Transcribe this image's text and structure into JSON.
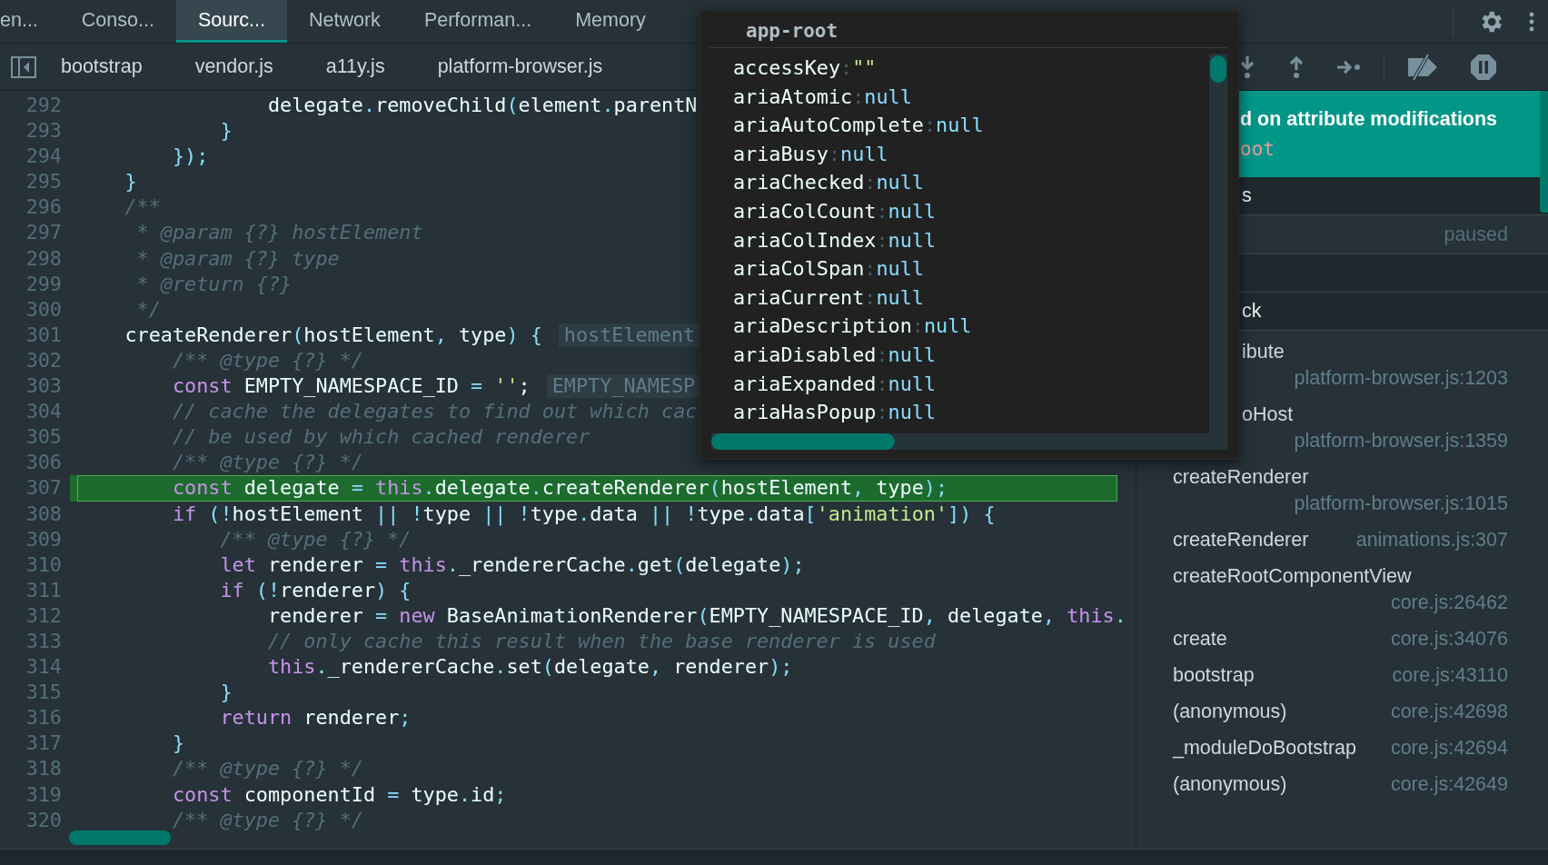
{
  "top_tabs": [
    {
      "label": "en...",
      "selected": false
    },
    {
      "label": "Conso...",
      "selected": false
    },
    {
      "label": "Sourc...",
      "selected": true
    },
    {
      "label": "Network",
      "selected": false
    },
    {
      "label": "Performan...",
      "selected": false
    },
    {
      "label": "Memory",
      "selected": false
    }
  ],
  "file_tabs": [
    "bootstrap",
    "vendor.js",
    "a11y.js",
    "platform-browser.js"
  ],
  "code": {
    "lines": [
      {
        "number": "292",
        "highlighted": false,
        "tokens": [
          {
            "text": "                delegate",
            "kind": "plain"
          },
          {
            "text": ".",
            "kind": "punct"
          },
          {
            "text": "removeChild",
            "kind": "plain"
          },
          {
            "text": "(",
            "kind": "punct"
          },
          {
            "text": "element",
            "kind": "plain"
          },
          {
            "text": ".",
            "kind": "punct"
          },
          {
            "text": "parentN",
            "kind": "plain"
          }
        ]
      },
      {
        "number": "293",
        "highlighted": false,
        "tokens": [
          {
            "text": "            }",
            "kind": "punct"
          }
        ]
      },
      {
        "number": "294",
        "highlighted": false,
        "tokens": [
          {
            "text": "        });",
            "kind": "punct"
          }
        ]
      },
      {
        "number": "295",
        "highlighted": false,
        "tokens": [
          {
            "text": "    }",
            "kind": "punct"
          }
        ]
      },
      {
        "number": "296",
        "highlighted": false,
        "tokens": [
          {
            "text": "    /**",
            "kind": "comment"
          }
        ]
      },
      {
        "number": "297",
        "highlighted": false,
        "tokens": [
          {
            "text": "     * @param {?} hostElement",
            "kind": "comment"
          }
        ]
      },
      {
        "number": "298",
        "highlighted": false,
        "tokens": [
          {
            "text": "     * @param {?} type",
            "kind": "comment"
          }
        ]
      },
      {
        "number": "299",
        "highlighted": false,
        "tokens": [
          {
            "text": "     * @return {?}",
            "kind": "comment"
          }
        ]
      },
      {
        "number": "300",
        "highlighted": false,
        "tokens": [
          {
            "text": "     */",
            "kind": "comment"
          }
        ]
      },
      {
        "number": "301",
        "highlighted": false,
        "tokens": [
          {
            "text": "    createRenderer",
            "kind": "plain"
          },
          {
            "text": "(",
            "kind": "punct"
          },
          {
            "text": "hostElement",
            "kind": "plain"
          },
          {
            "text": ", ",
            "kind": "punct"
          },
          {
            "text": "type",
            "kind": "plain"
          },
          {
            "text": ") {",
            "kind": "punct"
          }
        ],
        "hint": "hostElement"
      },
      {
        "number": "302",
        "highlighted": false,
        "tokens": [
          {
            "text": "        /** @type {?} */",
            "kind": "comment"
          }
        ]
      },
      {
        "number": "303",
        "highlighted": false,
        "tokens": [
          {
            "text": "        const",
            "kind": "keyword"
          },
          {
            "text": " EMPTY_NAMESPACE_ID ",
            "kind": "plain"
          },
          {
            "text": "= ",
            "kind": "punct"
          },
          {
            "text": "''",
            "kind": "string"
          },
          {
            "text": ";",
            "kind": "plain"
          }
        ],
        "hint": "EMPTY_NAMESP"
      },
      {
        "number": "304",
        "highlighted": false,
        "tokens": [
          {
            "text": "        // cache the delegates to find out which cac",
            "kind": "comment"
          }
        ]
      },
      {
        "number": "305",
        "highlighted": false,
        "tokens": [
          {
            "text": "        // be used by which cached renderer",
            "kind": "comment"
          }
        ]
      },
      {
        "number": "306",
        "highlighted": false,
        "tokens": [
          {
            "text": "        /** @type {?} */",
            "kind": "comment"
          }
        ]
      },
      {
        "number": "307",
        "highlighted": true,
        "tokens": [
          {
            "text": "        const",
            "kind": "keyword"
          },
          {
            "text": " delegate ",
            "kind": "plain"
          },
          {
            "text": "=",
            "kind": "punct"
          },
          {
            "text": " this",
            "kind": "keyword"
          },
          {
            "text": ".",
            "kind": "punct"
          },
          {
            "text": "delegate",
            "kind": "plain"
          },
          {
            "text": ".",
            "kind": "punct"
          },
          {
            "text": "createRenderer",
            "kind": "plain"
          },
          {
            "text": "(",
            "kind": "punct"
          },
          {
            "text": "hostElement",
            "kind": "plain"
          },
          {
            "text": ", ",
            "kind": "punct"
          },
          {
            "text": "type",
            "kind": "plain"
          },
          {
            "text": ");",
            "kind": "punct"
          }
        ]
      },
      {
        "number": "308",
        "highlighted": false,
        "tokens": [
          {
            "text": "        if",
            "kind": "keyword"
          },
          {
            "text": " (!",
            "kind": "punct"
          },
          {
            "text": "hostElement ",
            "kind": "plain"
          },
          {
            "text": "|| !",
            "kind": "punct"
          },
          {
            "text": "type ",
            "kind": "plain"
          },
          {
            "text": "|| !",
            "kind": "punct"
          },
          {
            "text": "type",
            "kind": "plain"
          },
          {
            "text": ".",
            "kind": "punct"
          },
          {
            "text": "data ",
            "kind": "plain"
          },
          {
            "text": "|| !",
            "kind": "punct"
          },
          {
            "text": "type",
            "kind": "plain"
          },
          {
            "text": ".",
            "kind": "punct"
          },
          {
            "text": "data",
            "kind": "plain"
          },
          {
            "text": "[",
            "kind": "punct"
          },
          {
            "text": "'animation'",
            "kind": "string"
          },
          {
            "text": "]) {",
            "kind": "punct"
          }
        ]
      },
      {
        "number": "309",
        "highlighted": false,
        "tokens": [
          {
            "text": "            /** @type {?} */",
            "kind": "comment"
          }
        ]
      },
      {
        "number": "310",
        "highlighted": false,
        "tokens": [
          {
            "text": "            let",
            "kind": "keyword"
          },
          {
            "text": " renderer ",
            "kind": "plain"
          },
          {
            "text": "=",
            "kind": "punct"
          },
          {
            "text": " this",
            "kind": "keyword"
          },
          {
            "text": ".",
            "kind": "punct"
          },
          {
            "text": "_rendererCache",
            "kind": "plain"
          },
          {
            "text": ".",
            "kind": "punct"
          },
          {
            "text": "get",
            "kind": "plain"
          },
          {
            "text": "(",
            "kind": "punct"
          },
          {
            "text": "delegate",
            "kind": "plain"
          },
          {
            "text": ");",
            "kind": "punct"
          }
        ]
      },
      {
        "number": "311",
        "highlighted": false,
        "tokens": [
          {
            "text": "            if",
            "kind": "keyword"
          },
          {
            "text": " (!",
            "kind": "punct"
          },
          {
            "text": "renderer",
            "kind": "plain"
          },
          {
            "text": ") {",
            "kind": "punct"
          }
        ]
      },
      {
        "number": "312",
        "highlighted": false,
        "tokens": [
          {
            "text": "                renderer ",
            "kind": "plain"
          },
          {
            "text": "=",
            "kind": "punct"
          },
          {
            "text": " new",
            "kind": "keyword"
          },
          {
            "text": " BaseAnimationRenderer",
            "kind": "plain"
          },
          {
            "text": "(",
            "kind": "punct"
          },
          {
            "text": "EMPTY_NAMESPACE_ID",
            "kind": "plain"
          },
          {
            "text": ", ",
            "kind": "punct"
          },
          {
            "text": "delegate",
            "kind": "plain"
          },
          {
            "text": ", ",
            "kind": "punct"
          },
          {
            "text": "this",
            "kind": "keyword"
          },
          {
            "text": ".",
            "kind": "punct"
          }
        ]
      },
      {
        "number": "313",
        "highlighted": false,
        "tokens": [
          {
            "text": "                // only cache this result when the base renderer is used",
            "kind": "comment"
          }
        ]
      },
      {
        "number": "314",
        "highlighted": false,
        "tokens": [
          {
            "text": "                this",
            "kind": "keyword"
          },
          {
            "text": ".",
            "kind": "punct"
          },
          {
            "text": "_rendererCache",
            "kind": "plain"
          },
          {
            "text": ".",
            "kind": "punct"
          },
          {
            "text": "set",
            "kind": "plain"
          },
          {
            "text": "(",
            "kind": "punct"
          },
          {
            "text": "delegate",
            "kind": "plain"
          },
          {
            "text": ", ",
            "kind": "punct"
          },
          {
            "text": "renderer",
            "kind": "plain"
          },
          {
            "text": ");",
            "kind": "punct"
          }
        ]
      },
      {
        "number": "315",
        "highlighted": false,
        "tokens": [
          {
            "text": "            }",
            "kind": "punct"
          }
        ]
      },
      {
        "number": "316",
        "highlighted": false,
        "tokens": [
          {
            "text": "            return",
            "kind": "keyword"
          },
          {
            "text": " renderer",
            "kind": "plain"
          },
          {
            "text": ";",
            "kind": "punct"
          }
        ]
      },
      {
        "number": "317",
        "highlighted": false,
        "tokens": [
          {
            "text": "        }",
            "kind": "punct"
          }
        ]
      },
      {
        "number": "318",
        "highlighted": false,
        "tokens": [
          {
            "text": "        /** @type {?} */",
            "kind": "comment"
          }
        ]
      },
      {
        "number": "319",
        "highlighted": false,
        "tokens": [
          {
            "text": "        const",
            "kind": "keyword"
          },
          {
            "text": " componentId ",
            "kind": "plain"
          },
          {
            "text": "=",
            "kind": "punct"
          },
          {
            "text": " type",
            "kind": "plain"
          },
          {
            "text": ".",
            "kind": "punct"
          },
          {
            "text": "id",
            "kind": "plain"
          },
          {
            "text": ";",
            "kind": "punct"
          }
        ]
      },
      {
        "number": "320",
        "highlighted": false,
        "tokens": [
          {
            "text": "        /** @type {?} */",
            "kind": "comment"
          }
        ]
      }
    ]
  },
  "popover": {
    "title": "app-root",
    "properties": [
      {
        "name": "accessKey",
        "separator": ":",
        "value": "\"\"",
        "kind": "string"
      },
      {
        "name": "ariaAtomic",
        "separator": ":",
        "value": "null",
        "kind": "null"
      },
      {
        "name": "ariaAutoComplete",
        "separator": ":",
        "value": "null",
        "kind": "null"
      },
      {
        "name": "ariaBusy",
        "separator": ":",
        "value": "null",
        "kind": "null"
      },
      {
        "name": "ariaChecked",
        "separator": ":",
        "value": "null",
        "kind": "null"
      },
      {
        "name": "ariaColCount",
        "separator": ":",
        "value": "null",
        "kind": "null"
      },
      {
        "name": "ariaColIndex",
        "separator": ":",
        "value": "null",
        "kind": "null"
      },
      {
        "name": "ariaColSpan",
        "separator": ":",
        "value": "null",
        "kind": "null"
      },
      {
        "name": "ariaCurrent",
        "separator": ":",
        "value": "null",
        "kind": "null"
      },
      {
        "name": "ariaDescription",
        "separator": ":",
        "value": "null",
        "kind": "null"
      },
      {
        "name": "ariaDisabled",
        "separator": ":",
        "value": "null",
        "kind": "null"
      },
      {
        "name": "ariaExpanded",
        "separator": ":",
        "value": "null",
        "kind": "null"
      },
      {
        "name": "ariaHasPopup",
        "separator": ":",
        "value": "null",
        "kind": "null"
      }
    ]
  },
  "breakpoint_banner": {
    "reason": "d on attribute modifications",
    "node": "oot"
  },
  "sidebar_sections": [
    {
      "kind": "header",
      "label": "s"
    },
    {
      "kind": "message",
      "label": "paused"
    },
    {
      "kind": "header"
    },
    {
      "kind": "header",
      "label": "ck"
    }
  ],
  "call_stack": [
    {
      "function": "ibute",
      "location": "platform-browser.js:1203",
      "clipped": true
    },
    {
      "function": "oHost",
      "location": "platform-browser.js:1359",
      "clipped": true
    },
    {
      "function": "createRenderer",
      "location": "platform-browser.js:1015",
      "clipped": false
    },
    {
      "function": "createRenderer",
      "location": "animations.js:307",
      "clipped": false
    },
    {
      "function": "createRootComponentView",
      "location": "core.js:26462",
      "clipped": false
    },
    {
      "function": "create",
      "location": "core.js:34076",
      "clipped": false
    },
    {
      "function": "bootstrap",
      "location": "core.js:43110",
      "clipped": false
    },
    {
      "function": "(anonymous)",
      "location": "core.js:42698",
      "clipped": false
    },
    {
      "function": "_moduleDoBootstrap",
      "location": "core.js:42694",
      "clipped": false
    },
    {
      "function": "(anonymous)",
      "location": "core.js:42649",
      "clipped": false
    }
  ]
}
